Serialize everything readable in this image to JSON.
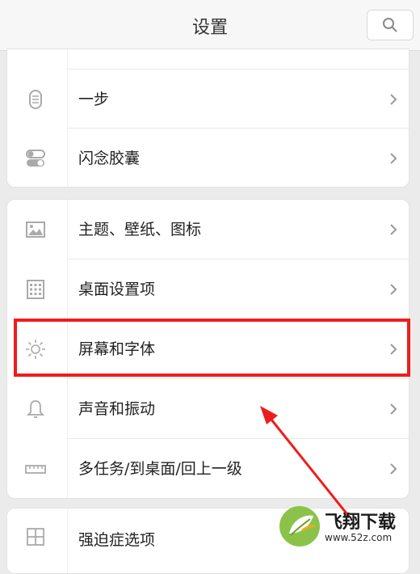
{
  "header": {
    "title": "设置"
  },
  "card1": {
    "items": [
      {
        "label": "一步",
        "icon": "capsule-icon"
      },
      {
        "label": "闪念胶囊",
        "icon": "toggle-icon"
      }
    ]
  },
  "card2": {
    "items": [
      {
        "label": "主题、壁纸、图标",
        "icon": "image-icon"
      },
      {
        "label": "桌面设置项",
        "icon": "grid-icon"
      },
      {
        "label": "屏幕和字体",
        "icon": "brightness-icon"
      },
      {
        "label": "声音和振动",
        "icon": "bell-icon"
      },
      {
        "label": "多任务/到桌面/回上一级",
        "icon": "ruler-icon"
      }
    ]
  },
  "card3": {
    "items": [
      {
        "label": "强迫症选项",
        "icon": "window-grid-icon"
      }
    ]
  },
  "annotation": {
    "highlight_color": "#ee1d1d",
    "highlighted_item": "屏幕和字体"
  },
  "watermark": {
    "text": "飞翔下载",
    "url": "www.52z.com"
  }
}
